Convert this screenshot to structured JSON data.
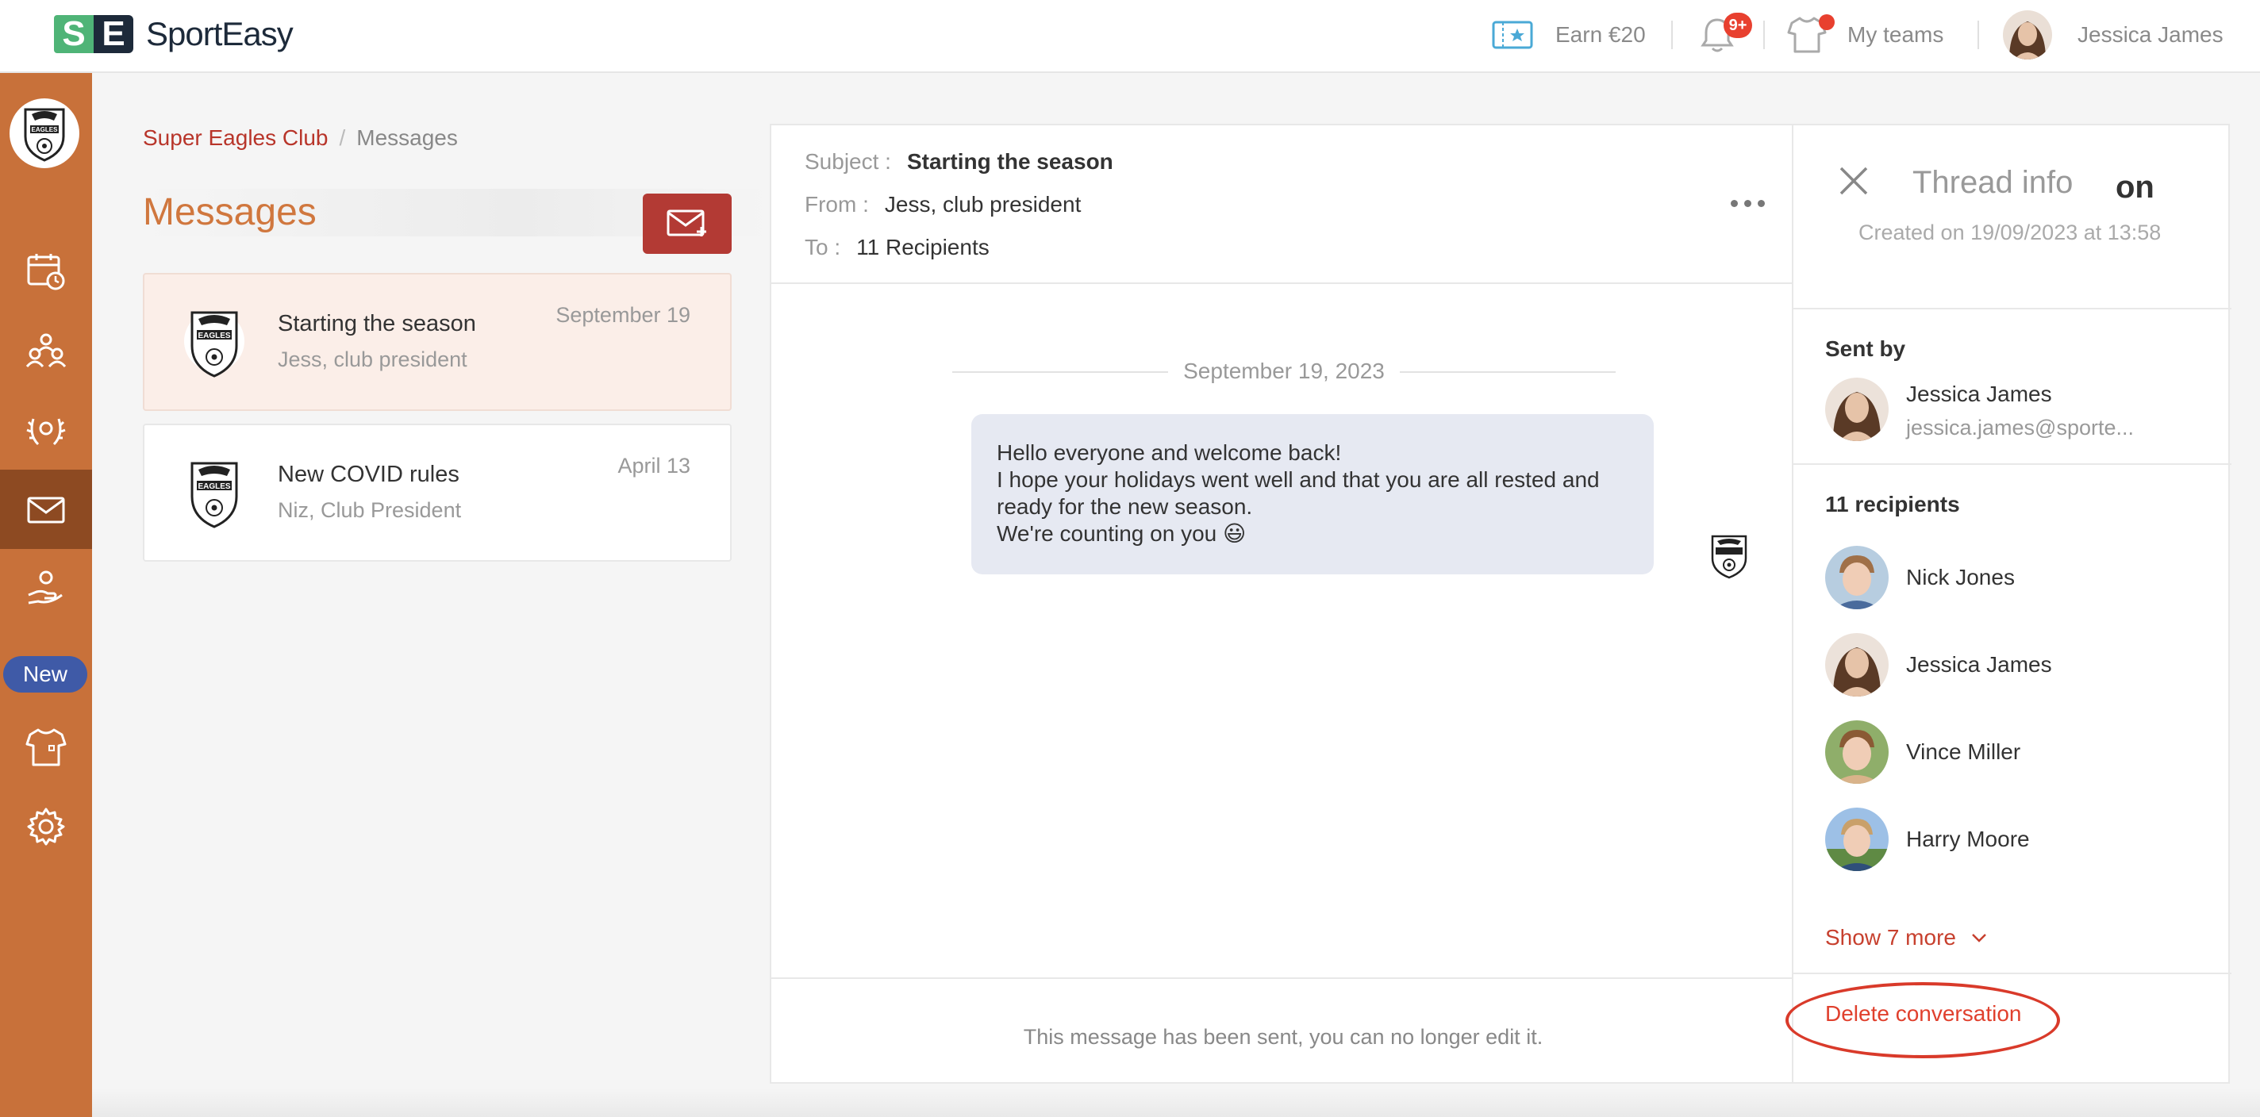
{
  "app": {
    "logo_letters": "SE",
    "name": "SportEasy"
  },
  "topbar": {
    "earn_label": "Earn €20",
    "notifications_badge": "9+",
    "my_teams_label": "My teams",
    "user_name": "Jessica James"
  },
  "sidebar": {
    "club_logo_text": "EAGLES",
    "new_badge": "New",
    "items": [
      {
        "icon": "calendar-icon"
      },
      {
        "icon": "members-icon"
      },
      {
        "icon": "laurel-icon"
      },
      {
        "icon": "mail-icon",
        "active": true
      },
      {
        "icon": "hand-heart-icon"
      },
      {
        "icon": "jersey-icon"
      },
      {
        "icon": "gear-icon"
      }
    ]
  },
  "breadcrumb": {
    "club": "Super Eagles Club",
    "separator": "/",
    "current": "Messages"
  },
  "messages": {
    "title": "Messages",
    "conversations": [
      {
        "title": "Starting the season",
        "sender": "Jess, club president",
        "date": "September 19",
        "selected": true
      },
      {
        "title": "New COVID rules",
        "sender": "Niz, Club President",
        "date": "April 13",
        "selected": false
      }
    ]
  },
  "thread": {
    "subject_label": "Subject :",
    "subject": "Starting the season",
    "from_label": "From :",
    "from": "Jess, club president",
    "to_label": "To :",
    "to": "11 Recipients",
    "date_separator": "September 19, 2023",
    "body_lines": [
      "Hello everyone and welcome back!",
      "I hope your holidays went well and that you are all rested and",
      "ready for the new season.",
      "We're counting on you 😃"
    ],
    "footer_notice": "This message has been sent, you can no longer edit it."
  },
  "info": {
    "title": "Thread info",
    "title_overlap": "on",
    "created": "Created on 19/09/2023 at 13:58",
    "sent_by_label": "Sent by",
    "sender_name": "Jessica James",
    "sender_email": "jessica.james@sporte...",
    "recipients_label": "11 recipients",
    "recipients": [
      {
        "name": "Nick Jones"
      },
      {
        "name": "Jessica James"
      },
      {
        "name": "Vince Miller"
      },
      {
        "name": "Harry Moore"
      }
    ],
    "show_more": "Show 7 more",
    "delete": "Delete conversation"
  },
  "colors": {
    "sidebar": "#c8713a",
    "sidebar_active": "#8d4a22",
    "accent_red": "#b33a34",
    "link_red": "#b8352a",
    "title_orange": "#d0773e",
    "bubble": "#e6e9f2",
    "new_pill": "#3f5aa7"
  }
}
